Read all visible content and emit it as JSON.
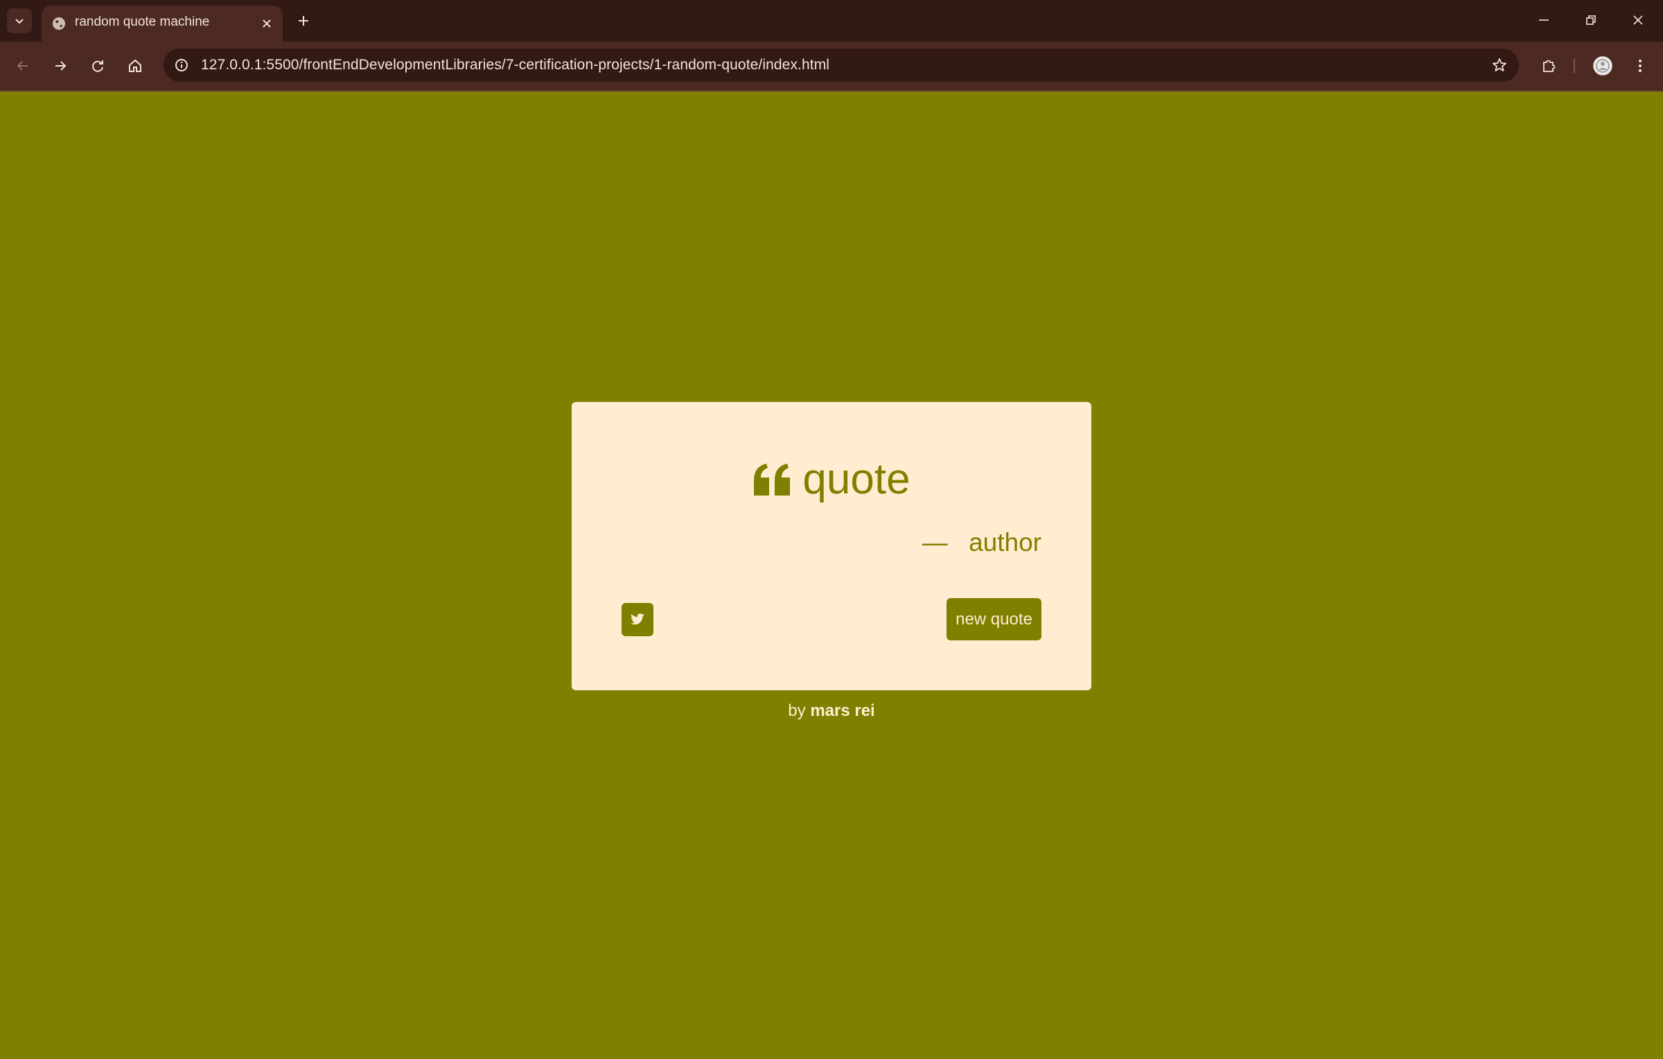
{
  "browser": {
    "tab_title": "random quote machine",
    "url": "127.0.0.1:5500/frontEndDevelopmentLibraries/7-certification-projects/1-random-quote/index.html",
    "icons": {
      "tab_search": "chevron-down-icon",
      "favicon": "globe-icon",
      "tab_close": "close-icon",
      "new_tab": "plus-icon",
      "minimize": "minimize-icon",
      "restore": "restore-icon",
      "close": "close-icon",
      "back": "arrow-left-icon",
      "forward": "arrow-right-icon",
      "reload": "reload-icon",
      "home": "home-icon",
      "site_info": "info-icon",
      "bookmark": "star-icon",
      "extensions": "puzzle-icon",
      "profile": "avatar-icon",
      "menu": "kebab-menu-icon"
    }
  },
  "page": {
    "background_color": "#808000",
    "box_color": "#ffedd1",
    "quote": {
      "text": "quote",
      "icon": "quote-left-icon"
    },
    "author": {
      "dash": "—",
      "name": "author"
    },
    "tweet_button": {
      "icon": "twitter-icon"
    },
    "new_quote_button": {
      "label": "new quote"
    },
    "credit": {
      "prefix": "by",
      "name": "mars rei"
    }
  }
}
